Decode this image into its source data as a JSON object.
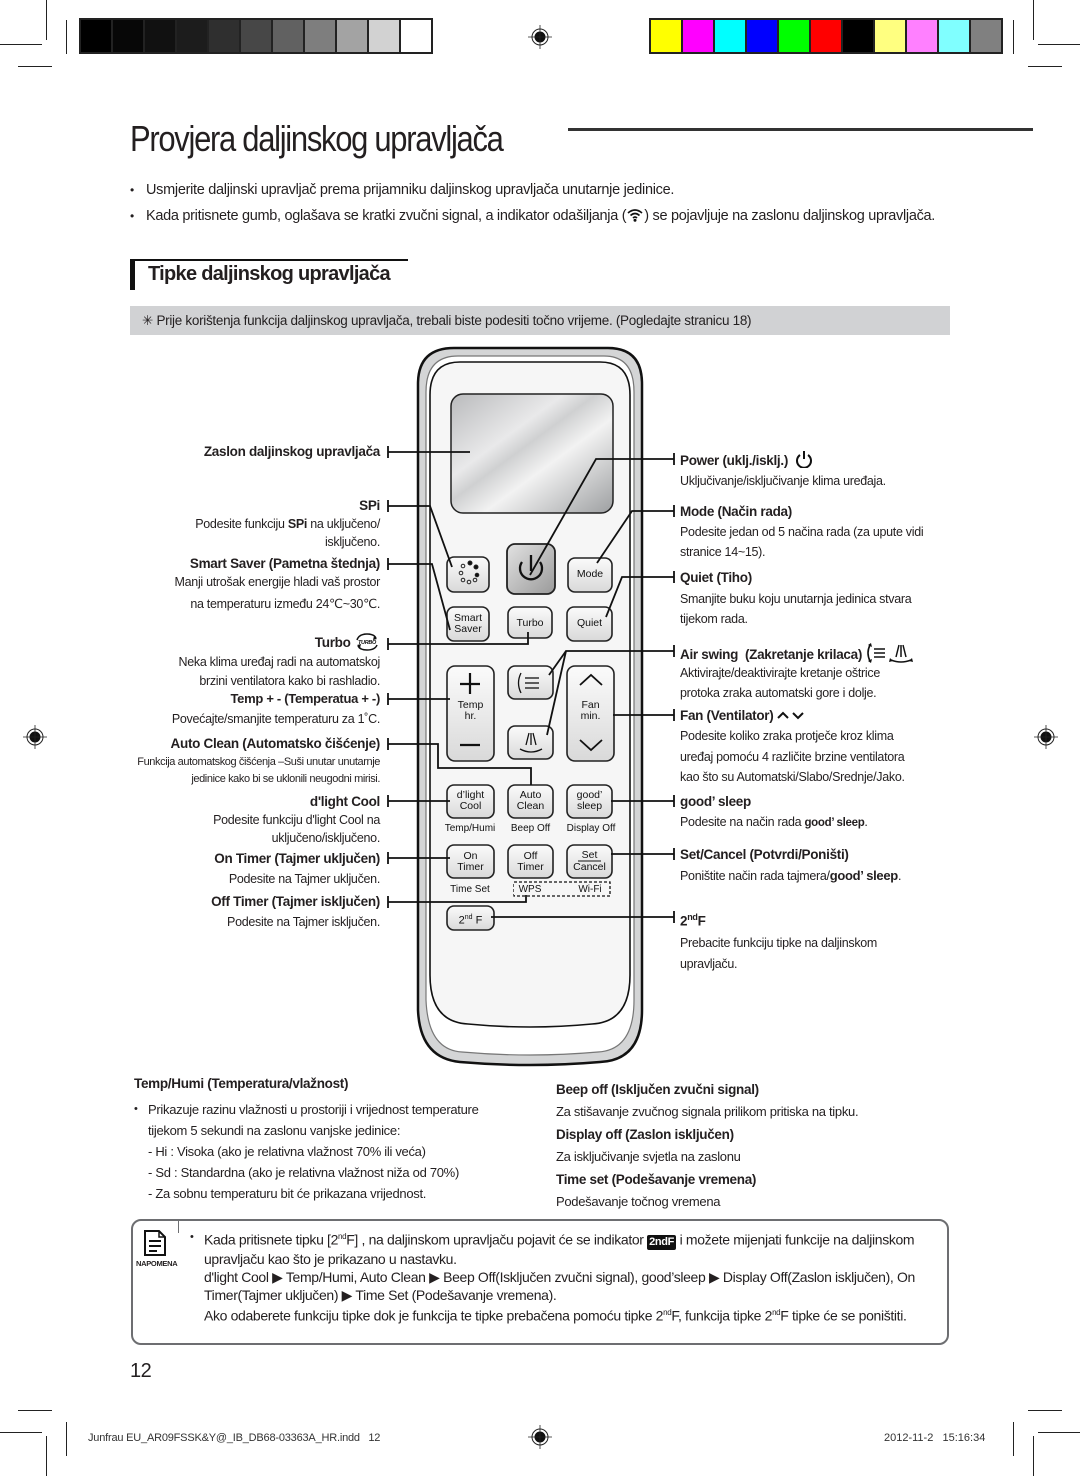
{
  "print_marks": {
    "gray_swatches": [
      "#000000",
      "#070707",
      "#111111",
      "#1c1c1c",
      "#2f2f2f",
      "#474747",
      "#616161",
      "#7e7e7e",
      "#a3a3a3",
      "#d2d2d2",
      "#ffffff"
    ],
    "color_swatches": [
      "#ffff00",
      "#ff00ff",
      "#00ffff",
      "#0000ff",
      "#00ff00",
      "#ff0000",
      "#000000",
      "#ffff80",
      "#ff80ff",
      "#80ffff",
      "#808080"
    ]
  },
  "page": {
    "title": "Provjera daljinskog upravljača",
    "bullets": [
      "Usmjerite daljinski upravljač prema prijamniku daljinskog upravljača unutarnje jedinice.",
      "Kada pritisnete gumb, oglašava se kratki zvučni signal, a indikator odašiljanja (",
      ") se pojavljuje na zaslonu daljinskog upravljača."
    ],
    "subheading": "Tipke daljinskog upravljača",
    "note_bar": "✳ Prije korištenja funkcija daljinskog upravljača, trebali biste podesiti točno vrijeme. (Pogledajte stranicu 18)",
    "page_number": "12"
  },
  "left_labels": {
    "display": "Zaslon daljinskog upravljača",
    "spi_title": "SPi",
    "spi_desc_1a": "Podesite funkciju ",
    "spi_desc_1b": "SPi",
    "spi_desc_1c": " na uključeno/",
    "spi_desc_2": "isključeno.",
    "smart_saver_title": "Smart Saver (Pametna štednja)",
    "smart_saver_desc_1": "Manji utrošak energije hladi vaš prostor",
    "smart_saver_desc_2": "na temperaturu između 24℃~30℃.",
    "turbo_title": "Turbo",
    "turbo_desc_1": "Neka klima uređaj radi na automatskoj",
    "turbo_desc_2": "brzini ventilatora kako bi rashladio.",
    "temp_title": "Temp + - (Temperatua + -)",
    "temp_desc": "Povećajte/smanjite temperaturu za 1˚C.",
    "autoclean_title": "Auto Clean (Automatsko čišćenje)",
    "autoclean_desc_1": "Funkcija automatskog čišćenja –Suši unutar unutarnje",
    "autoclean_desc_2": "jedinice kako bi se uklonili neugodni mirisi.",
    "dlight_title": "d'light Cool",
    "dlight_desc_1": "Podesite funkciju d'light Cool na",
    "dlight_desc_2": "uključeno/isključeno.",
    "ontimer_title": "On Timer (Tajmer uključen)",
    "ontimer_desc": "Podesite na Tajmer uključen.",
    "offtimer_title": "Off Timer (Tajmer isključen)",
    "offtimer_desc": "Podesite na Tajmer isključen."
  },
  "right_labels": {
    "power_title": "Power (uklj./isklj.)",
    "power_desc": "Uključivanje/isključivanje klima uređaja.",
    "mode_title": "Mode (Način rada)",
    "mode_desc_1": "Podesite jedan od 5 načina rada (za upute vidi",
    "mode_desc_2": "stranice 14~15).",
    "quiet_title": "Quiet (Tiho)",
    "quiet_desc_1": "Smanjite buku koju unutarnja jedinica stvara",
    "quiet_desc_2": "tijekom rada.",
    "airswing_title": "Air swing  (Zakretanje krilaca)",
    "airswing_desc_1": "Aktivirajte/deaktivirajte kretanje oštrice",
    "airswing_desc_2": "protoka zraka automatski gore i dolje.",
    "fan_title": "Fan (Ventilator)",
    "fan_desc_1": "Podesite koliko zraka protječe kroz klima",
    "fan_desc_2": "uređaj pomoću 4 različite brzine ventilatora",
    "fan_desc_3": "kao što su Automatski/Slabo/Srednje/Jako.",
    "goodsleep_title": "good’ sleep",
    "goodsleep_desc_a": "Podesite na način rada ",
    "goodsleep_desc_b": "good’ sleep",
    "goodsleep_desc_c": ".",
    "setcancel_title": "Set/Cancel (Potvrdi/Poništi)",
    "setcancel_desc_a": "Poništite način rada tajmera/",
    "setcancel_desc_b": "good’ sleep",
    "setcancel_desc_c": ".",
    "second_f_title_a": "2",
    "second_f_title_sup": "nd",
    "second_f_title_b": "F",
    "second_f_desc_1": "Prebacite funkciju tipke na daljinskom",
    "second_f_desc_2": "upravljaču."
  },
  "remote_buttons": {
    "mode": "Mode",
    "smart_1": "Smart",
    "smart_2": "Saver",
    "turbo": "Turbo",
    "quiet": "Quiet",
    "temp": "Temp",
    "hr": "hr.",
    "fan": "Fan",
    "min": "min.",
    "dlight_1": "d’light",
    "dlight_2": "Cool",
    "auto_1": "Auto",
    "auto_2": "Clean",
    "good_1": "good’",
    "good_2": "sleep",
    "temp_humi": "Temp/Humi",
    "beep_off": "Beep Off",
    "display_off": "Display Off",
    "on_1": "On",
    "on_2": "Timer",
    "off_1": "Off",
    "off_2": "Timer",
    "set": "Set",
    "cancel": "Cancel",
    "time_set": "Time Set",
    "wps": "WPS",
    "wifi": "Wi-Fi",
    "second_f": "2",
    "second_f_sup": "nd",
    "second_f_b": " F"
  },
  "bottom_sections": {
    "temphumi_title": "Temp/Humi (Temperatura/vlažnost)",
    "temphumi_bullet_1": "Prikazuje razinu vlažnosti u prostoriji i vrijednost temperature",
    "temphumi_bullet_2": "tijekom 5 sekundi na zaslonu vanjske jedinice:",
    "temphumi_hi": "- Hi : Visoka (ako je relativna vlažnost 70% ili veća)",
    "temphumi_sd": "- Sd : Standardna (ako je relativna vlažnost niža od 70%)",
    "temphumi_room": "- Za sobnu temperaturu bit će prikazana vrijednost.",
    "beep_title": "Beep off (Isključen zvučni signal)",
    "beep_desc": "Za stišavanje zvučnog signala prilikom pritiska na tipku.",
    "display_title": "Display off (Zaslon isključen)",
    "display_desc": "Za isključivanje svjetla na zaslonu",
    "timeset_title": "Time set (Podešavanje vremena)",
    "timeset_desc": "Podešavanje točnog vremena"
  },
  "note_box": {
    "label": "NAPOMENA",
    "line1_a": "Kada pritisnete tipku [2",
    "line1_sup": "nd",
    "line1_b": "F] , na daljinskom upravljaču pojavit će se indikator ",
    "badge": "2ndF",
    "line1_c": " i možete mijenjati funkcije na daljinskom upravljaču kao što je prikazano u nastavku.",
    "line2": "d'light Cool ▶ Temp/Humi, Auto Clean ▶ Beep Off(Isključen zvučni signal), good’sleep ▶ Display Off(Zaslon isključen), On Timer(Tajmer uključen) ▶ Time Set (Podešavanje vremena).",
    "line3_a": "Ako odaberete funkciju tipke dok je funkcija te tipke prebačena pomoću tipke 2",
    "line3_sup1": "nd",
    "line3_b": "F, funkcija tipke 2",
    "line3_sup2": "nd",
    "line3_c": "F tipke će se poništiti."
  },
  "footer": {
    "file": "Junfrau EU_AR09FSSK&Y@_IB_DB68-03363A_HR.indd   12",
    "timestamp": "2012-11-2   15:16:34"
  }
}
